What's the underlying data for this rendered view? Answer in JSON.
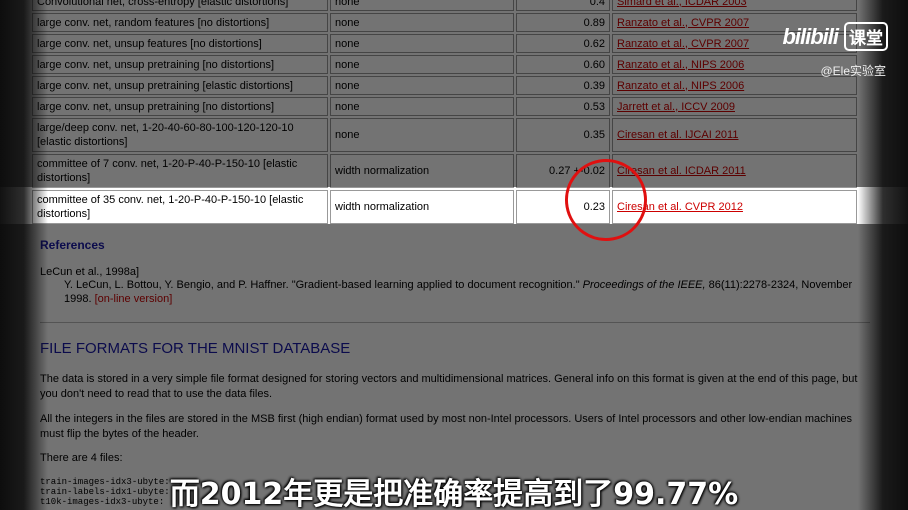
{
  "table": {
    "rows": [
      {
        "classifier": "Convolutional net, cross-entropy [elastic distortions]",
        "preprocessing": "none",
        "error": "0.4",
        "ref": "Simard et al., ICDAR 2003"
      },
      {
        "classifier": "large conv. net, random features [no distortions]",
        "preprocessing": "none",
        "error": "0.89",
        "ref": "Ranzato et al., CVPR 2007"
      },
      {
        "classifier": "large conv. net, unsup features [no distortions]",
        "preprocessing": "none",
        "error": "0.62",
        "ref": "Ranzato et al., CVPR 2007"
      },
      {
        "classifier": "large conv. net, unsup pretraining [no distortions]",
        "preprocessing": "none",
        "error": "0.60",
        "ref": "Ranzato et al., NIPS 2006"
      },
      {
        "classifier": "large conv. net, unsup pretraining [elastic distortions]",
        "preprocessing": "none",
        "error": "0.39",
        "ref": "Ranzato et al., NIPS 2006"
      },
      {
        "classifier": "large conv. net, unsup pretraining [no distortions]",
        "preprocessing": "none",
        "error": "0.53",
        "ref": "Jarrett et al., ICCV 2009"
      },
      {
        "classifier": "large/deep conv. net, 1-20-40-60-80-100-120-120-10 [elastic distortions]",
        "preprocessing": "none",
        "error": "0.35",
        "ref": "Ciresan et al. IJCAI 2011"
      },
      {
        "classifier": "committee of 7 conv. net, 1-20-P-40-P-150-10 [elastic distortions]",
        "preprocessing": "width normalization",
        "error": "0.27 +-0.02",
        "ref": "Ciresan et al. ICDAR 2011"
      },
      {
        "classifier": "committee of 35 conv. net, 1-20-P-40-P-150-10 [elastic distortions]",
        "preprocessing": "width normalization",
        "error": "0.23",
        "ref": "Ciresan et al. CVPR 2012"
      }
    ]
  },
  "references": {
    "heading": "References",
    "key": "LeCun et al., 1998a]",
    "authors_text": "Y. LeCun, L. Bottou, Y. Bengio, and P. Haffner. \"Gradient-based learning applied to document recognition.\"",
    "journal": "Proceedings of the IEEE,",
    "pages": "86(11):2278-2324, November",
    "year": "1998.",
    "link": "[on-line version]"
  },
  "file_formats": {
    "title": "FILE FORMATS FOR THE MNIST DATABASE",
    "para1": "The data is stored in a very simple file format designed for storing vectors and multidimensional matrices. General info on this format is given at the end of this page, but you don't need to read that to use the data files.",
    "para2": "All the integers in the files are stored in the MSB first (high endian) format used by most non-Intel processors. Users of Intel processors and other low-endian machines must flip the bytes of the header.",
    "para3": "There are 4 files:",
    "files": "train-images-idx3-ubyte:\ntrain-labels-idx1-ubyte:\nt10k-images-idx3-ubyte:"
  },
  "watermark": {
    "brand": "bilibili",
    "badge": "课堂",
    "handle": "@Ele实验室"
  },
  "subtitle": "而2012年更是把准确率提高到了99.77%",
  "colors": {
    "link": "#cc0000",
    "heading": "#1a1aa8",
    "circle": "#e01010"
  }
}
